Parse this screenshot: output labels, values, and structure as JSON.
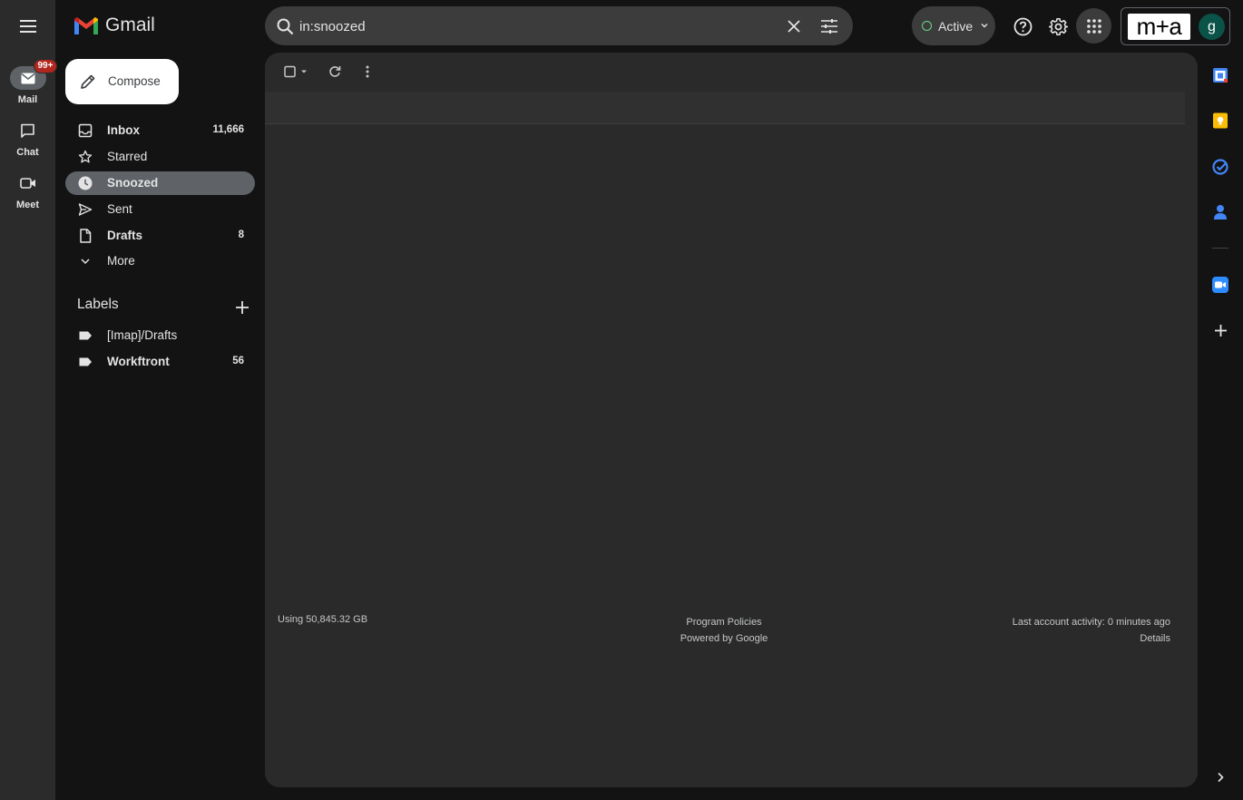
{
  "app": {
    "name": "Gmail"
  },
  "rail": {
    "items": [
      {
        "label": "Mail",
        "badge": "99+"
      },
      {
        "label": "Chat"
      },
      {
        "label": "Meet"
      }
    ]
  },
  "search": {
    "value": "in:snoozed"
  },
  "status": {
    "label": "Active",
    "color": "#6dd58c"
  },
  "account": {
    "org_logo_text": "m+a",
    "avatar_letter": "g",
    "avatar_color": "#0b5348"
  },
  "compose": {
    "label": "Compose"
  },
  "nav": {
    "items": [
      {
        "label": "Inbox",
        "count": "11,666",
        "icon": "inbox-icon",
        "bold": true
      },
      {
        "label": "Starred",
        "count": "",
        "icon": "star-icon",
        "bold": false
      },
      {
        "label": "Snoozed",
        "count": "",
        "icon": "clock-icon",
        "bold": true,
        "selected": true
      },
      {
        "label": "Sent",
        "count": "",
        "icon": "send-icon",
        "bold": false
      },
      {
        "label": "Drafts",
        "count": "8",
        "icon": "draft-icon",
        "bold": true
      },
      {
        "label": "More",
        "count": "",
        "icon": "chevron-down-icon",
        "bold": false
      }
    ]
  },
  "labels": {
    "heading": "Labels",
    "items": [
      {
        "label": "[Imap]/Drafts",
        "count": "",
        "bold": false
      },
      {
        "label": "Workftront",
        "count": "56",
        "bold": true
      }
    ]
  },
  "footer": {
    "storage": "Using 50,845.32 GB",
    "policies": "Program Policies",
    "powered": "Powered by Google",
    "activity": "Last account activity: 0 minutes ago",
    "details": "Details"
  },
  "side_panel_icons": [
    "calendar-icon",
    "keep-icon",
    "tasks-icon",
    "contacts-icon",
    "zoom-icon",
    "add-icon"
  ]
}
